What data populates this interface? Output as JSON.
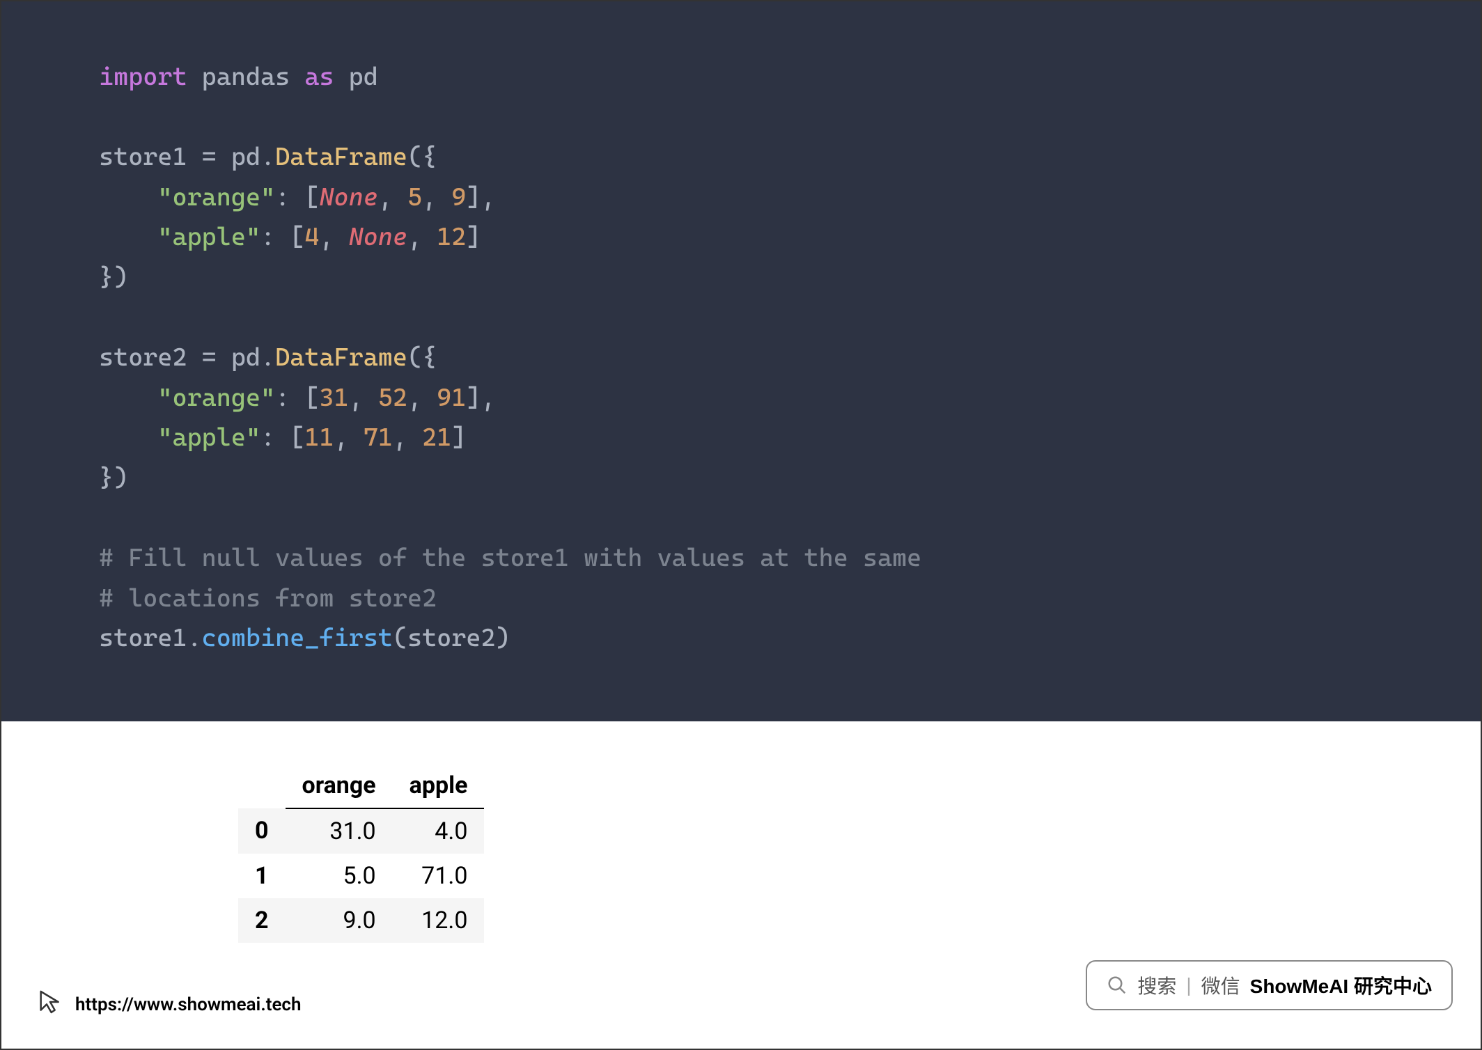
{
  "code": {
    "line1": {
      "import": "import",
      "mod": "pandas",
      "as": "as",
      "alias": "pd"
    },
    "line3": {
      "var": "store1",
      "eq": "=",
      "pd": "pd",
      "dot": ".",
      "cls": "DataFrame",
      "open": "({"
    },
    "line4": {
      "key": "\"orange\"",
      "colon": ":",
      "lb": "[",
      "v1": "None",
      "c1": ",",
      "v2": "5",
      "c2": ",",
      "v3": "9",
      "rb": "],"
    },
    "line5": {
      "key": "\"apple\"",
      "colon": ":",
      "lb": "[",
      "v1": "4",
      "c1": ",",
      "v2": "None",
      "c2": ",",
      "v3": "12",
      "rb": "]"
    },
    "line6": {
      "close": "})"
    },
    "line8": {
      "var": "store2",
      "eq": "=",
      "pd": "pd",
      "dot": ".",
      "cls": "DataFrame",
      "open": "({"
    },
    "line9": {
      "key": "\"orange\"",
      "colon": ":",
      "lb": "[",
      "v1": "31",
      "c1": ",",
      "v2": "52",
      "c2": ",",
      "v3": "91",
      "rb": "],"
    },
    "line10": {
      "key": "\"apple\"",
      "colon": ":",
      "lb": "[",
      "v1": "11",
      "c1": ",",
      "v2": "71",
      "c2": ",",
      "v3": "21",
      "rb": "]"
    },
    "line11": {
      "close": "})"
    },
    "line13": {
      "text": "# Fill null values of the store1 with values at the same "
    },
    "line14": {
      "text": "# locations from store2"
    },
    "line15": {
      "obj": "store1",
      "dot": ".",
      "method": "combine_first",
      "args": "(store2)"
    }
  },
  "output": {
    "columns": [
      "orange",
      "apple"
    ],
    "index": [
      "0",
      "1",
      "2"
    ],
    "rows": [
      [
        "31.0",
        "4.0"
      ],
      [
        "5.0",
        "71.0"
      ],
      [
        "9.0",
        "12.0"
      ]
    ]
  },
  "footer": {
    "url": "https://www.showmeai.tech"
  },
  "search_badge": {
    "search": "搜索",
    "sep": "|",
    "wechat": "微信",
    "brand": "ShowMeAI 研究中心"
  },
  "chart_data": {
    "type": "table",
    "title": "",
    "columns": [
      "orange",
      "apple"
    ],
    "index": [
      0,
      1,
      2
    ],
    "rows": [
      [
        31.0,
        4.0
      ],
      [
        5.0,
        71.0
      ],
      [
        9.0,
        12.0
      ]
    ]
  }
}
